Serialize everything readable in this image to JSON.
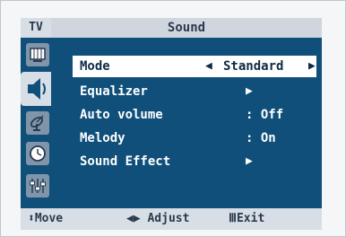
{
  "header": {
    "source_label": "TV",
    "title": "Sound"
  },
  "sidebar": {
    "tabs": [
      {
        "name": "picture-tab",
        "icon": "picture-icon"
      },
      {
        "name": "sound-tab",
        "icon": "speaker-icon",
        "selected": true
      },
      {
        "name": "channel-tab",
        "icon": "antenna-icon"
      },
      {
        "name": "setup-tab",
        "icon": "clock-icon"
      },
      {
        "name": "function-tab",
        "icon": "sliders-icon"
      }
    ]
  },
  "menu": {
    "items": [
      {
        "label": "Mode",
        "value": "Standard",
        "type": "selector",
        "selected": true
      },
      {
        "label": "Equalizer",
        "value": "",
        "type": "submenu"
      },
      {
        "label": "Auto volume",
        "value": ": Off",
        "type": "value"
      },
      {
        "label": "Melody",
        "value": ": On",
        "type": "value"
      },
      {
        "label": "Sound Effect",
        "value": "",
        "type": "submenu"
      }
    ]
  },
  "footer": {
    "move": "Move",
    "adjust": "Adjust",
    "exit": "Exit"
  },
  "colors": {
    "menu_bg": "#0f4f7a",
    "panel": "#d8dee6",
    "text_dark": "#2b3a4e"
  }
}
